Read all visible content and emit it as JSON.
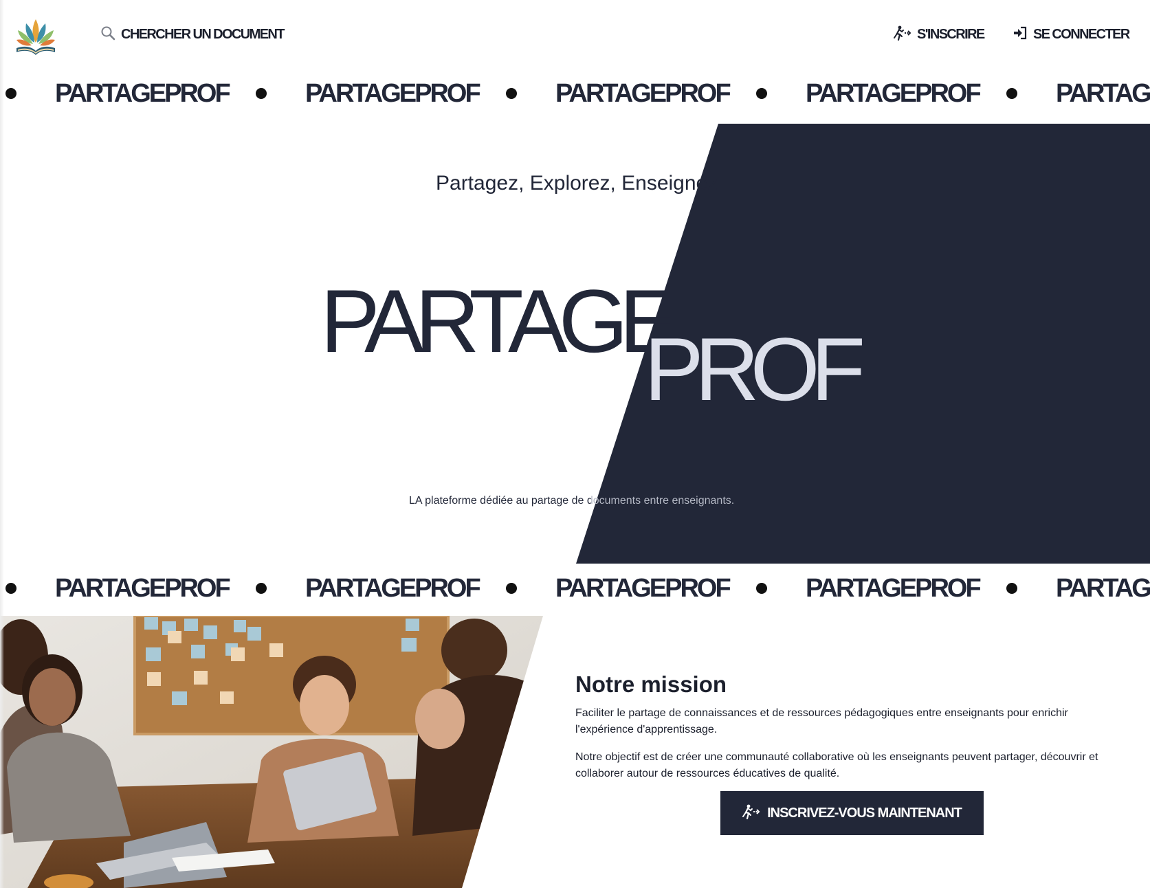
{
  "header": {
    "logo_alt": "Logo",
    "search_label": "CHERCHER UN DOCUMENT",
    "signup_label": "S'INSCRIRE",
    "login_label": "SE CONNECTER"
  },
  "marquee": {
    "word": "PARTAGEPROF"
  },
  "hero": {
    "tagline": "Partagez, Explorez, Enseignez",
    "title_part1": "PARTAGE",
    "title_part2": "PROF",
    "subtitle": "LA plateforme dédiée au partage de documents entre enseignants."
  },
  "mission": {
    "title": "Notre mission",
    "paragraph1": "Faciliter le partage de connaissances et de ressources pédagogiques entre enseignants pour enrichir l'expérience d'apprentissage.",
    "paragraph2": "Notre objectif est de créer une communauté collaborative où les enseignants peuvent partager, découvrir et collaborer autour de ressources éducatives de qualité.",
    "cta_label": "INSCRIVEZ-VOUS MAINTENANT"
  },
  "colors": {
    "navy": "#222738",
    "light_text": "#dcdfea",
    "background": "#ffffff"
  },
  "icons": {
    "logo": "tree-book-logo",
    "search": "search-icon",
    "signup": "person-running-icon",
    "login": "sign-in-icon",
    "cta": "person-running-icon"
  }
}
